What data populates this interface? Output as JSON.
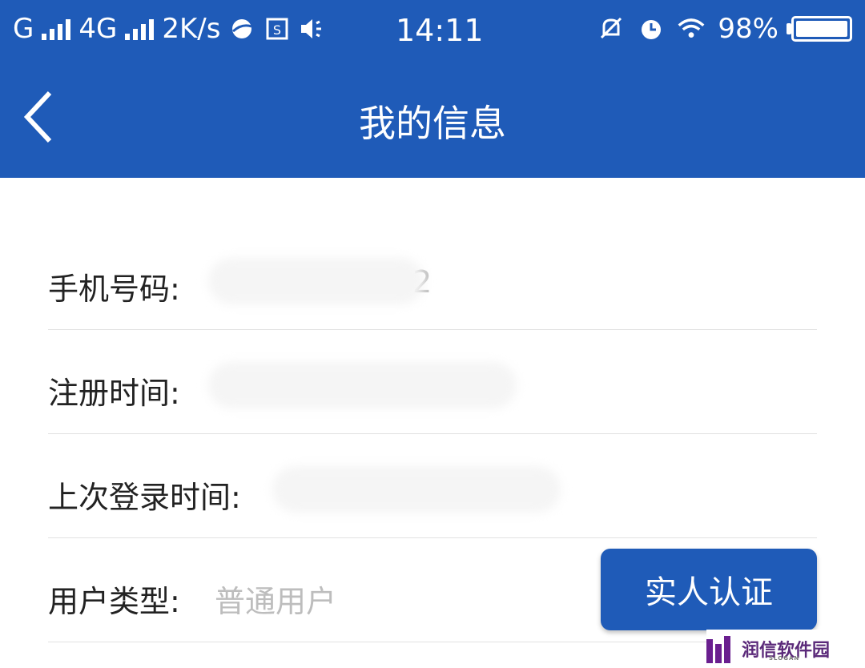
{
  "status_bar": {
    "net1": "G",
    "net2": "4G",
    "speed": "2K/s",
    "time": "14:11",
    "battery": "98%"
  },
  "header": {
    "title": "我的信息"
  },
  "rows": [
    {
      "label": "手机号码:",
      "value": "0753492"
    },
    {
      "label": "注册时间:",
      "value": ""
    },
    {
      "label": "上次登录时间:",
      "value": ""
    },
    {
      "label": "用户类型:",
      "value": "普通用户"
    }
  ],
  "actions": {
    "verify_button": "实人认证"
  },
  "watermark": {
    "text": "润信软件园",
    "slogan": "SLOGAN"
  },
  "colors": {
    "primary": "#1f5bb8",
    "divider": "#e1e1e1",
    "label": "#222222",
    "value": "#bdbdbd"
  }
}
